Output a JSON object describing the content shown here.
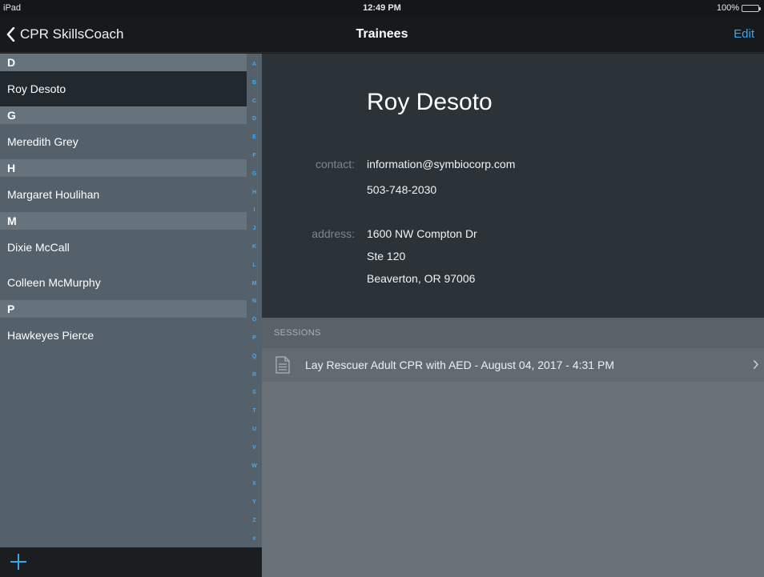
{
  "status_bar": {
    "carrier": "iPad",
    "time": "12:49 PM",
    "battery": "100%",
    "battery_level": 1.0
  },
  "navbar": {
    "back_label": "CPR SkillsCoach",
    "title": "Trainees",
    "edit_label": "Edit"
  },
  "sidebar": {
    "rows": [
      {
        "kind": "header",
        "label": "D"
      },
      {
        "kind": "item",
        "label": "Roy Desoto",
        "selected": true
      },
      {
        "kind": "header",
        "label": "G"
      },
      {
        "kind": "item",
        "label": "Meredith Grey",
        "selected": false
      },
      {
        "kind": "header",
        "label": "H"
      },
      {
        "kind": "item",
        "label": "Margaret Houlihan",
        "selected": false
      },
      {
        "kind": "header",
        "label": "M"
      },
      {
        "kind": "item",
        "label": "Dixie McCall",
        "selected": false
      },
      {
        "kind": "item",
        "label": "Colleen McMurphy",
        "selected": false
      },
      {
        "kind": "header",
        "label": "P"
      },
      {
        "kind": "item",
        "label": "Hawkeyes Pierce",
        "selected": false
      }
    ],
    "index_letters": [
      "A",
      "B",
      "C",
      "D",
      "E",
      "F",
      "G",
      "H",
      "I",
      "J",
      "K",
      "L",
      "M",
      "N",
      "O",
      "P",
      "Q",
      "R",
      "S",
      "T",
      "U",
      "V",
      "W",
      "X",
      "Y",
      "Z",
      "#"
    ]
  },
  "detail": {
    "name": "Roy Desoto",
    "contact_label": "contact:",
    "email": "information@symbiocorp.com",
    "phone": "503-748-2030",
    "address_label": "address:",
    "address_line1": "1600 NW Compton Dr",
    "address_line2": "Ste 120",
    "address_line3": "Beaverton, OR 97006",
    "sessions_header": "SESSIONS",
    "sessions": [
      {
        "label": "Lay Rescuer Adult CPR with AED - August 04, 2017 - 4:31 PM",
        "icon": "document-icon"
      }
    ]
  },
  "colors": {
    "accent": "#3ba6e8",
    "selected_row": "#22292e",
    "sidebar_bg": "#54616b",
    "detail_card": "#2b3338"
  },
  "icons": {
    "back": "chevron-left-icon",
    "add": "plus-icon",
    "session_disclosure": "chevron-right-icon"
  }
}
